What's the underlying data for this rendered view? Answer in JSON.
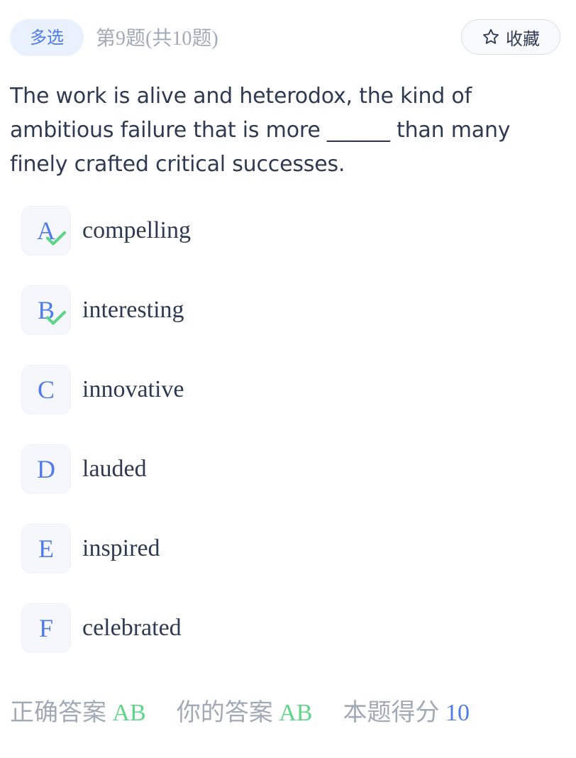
{
  "header": {
    "type_label": "多选",
    "progress_text": "第9题(共10题)",
    "favorite_label": "收藏"
  },
  "question": {
    "text": "The work is alive and heterodox, the kind of ambitious failure that is more ______ than many finely crafted critical successes."
  },
  "options": [
    {
      "letter": "A",
      "text": "compelling",
      "selected": true
    },
    {
      "letter": "B",
      "text": "interesting",
      "selected": true
    },
    {
      "letter": "C",
      "text": "innovative",
      "selected": false
    },
    {
      "letter": "D",
      "text": "lauded",
      "selected": false
    },
    {
      "letter": "E",
      "text": "inspired",
      "selected": false
    },
    {
      "letter": "F",
      "text": "celebrated",
      "selected": false
    }
  ],
  "result": {
    "correct_label": "正确答案",
    "correct_value": "AB",
    "your_label": "你的答案",
    "your_value": "AB",
    "score_label": "本题得分",
    "score_value": "10"
  },
  "colors": {
    "accent": "#4f7bec",
    "correct": "#5fd58a",
    "muted": "#a3aab7",
    "text": "#2f3a52"
  },
  "icons": {
    "favorite": "star-outline-icon",
    "selected_mark": "check-icon"
  }
}
